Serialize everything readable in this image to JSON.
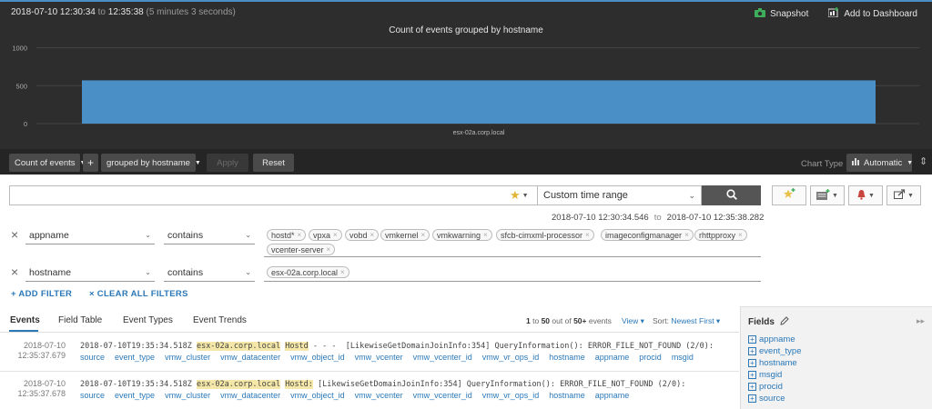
{
  "header": {
    "range_start": "2018-07-10 12:30:34",
    "range_to": "to",
    "range_end": "12:35:38",
    "range_duration": "(5 minutes 3 seconds)",
    "snapshot_label": "Snapshot",
    "add_dashboard_label": "Add to Dashboard"
  },
  "colors": {
    "accent": "#2a78b8",
    "bar": "#4a90c6",
    "dark_bg": "#2d2d2d",
    "highlight": "#f4e7a8"
  },
  "chart_data": {
    "type": "bar",
    "title": "Count of events grouped by hostname",
    "categories": [
      "esx-02a.corp.local"
    ],
    "values": [
      570
    ],
    "yticks": [
      0,
      500,
      1000
    ],
    "ylim": [
      0,
      1150
    ],
    "xlabel": "",
    "ylabel": "",
    "grid": true
  },
  "chart_toolbar": {
    "metric_label": "Count of events",
    "add_label": "+",
    "group_label": "grouped by hostname",
    "apply_label": "Apply",
    "reset_label": "Reset",
    "chart_type_label": "Chart Type",
    "chart_type_value": "Automatic",
    "collapse_label": "⇕"
  },
  "search": {
    "query_value": "",
    "time_range": "Custom time range",
    "time_start": "2018-07-10 12:30:34.546",
    "time_to": "to",
    "time_end": "2018-07-10 12:35:38.282"
  },
  "filters": [
    {
      "field": "appname",
      "operator": "contains",
      "tokens": [
        "hostd*",
        "vpxa",
        "vobd",
        "vmkernel",
        "vmkwarning",
        "sfcb-cimxml-processor",
        "imageconfigmanager",
        "rhttpproxy",
        "vcenter-server"
      ]
    },
    {
      "field": "hostname",
      "operator": "contains",
      "tokens": [
        "esx-02a.corp.local"
      ]
    }
  ],
  "filter_actions": {
    "add_label": "+ ADD FILTER",
    "clear_label": "× CLEAR ALL FILTERS"
  },
  "tabs": [
    "Events",
    "Field Table",
    "Event Types",
    "Event Trends"
  ],
  "results": {
    "range_from": "1",
    "to_word": "to",
    "range_to": "50",
    "out_of": "out of",
    "total": "50+",
    "events_word": "events",
    "view_label": "View ▾",
    "sort_label": "Sort:",
    "sort_value": "Newest First ▾"
  },
  "events": [
    {
      "date": "2018-07-10",
      "time": "12:35:37.679",
      "timestamp": "2018-07-10T19:35:34.518Z",
      "host": "esx-02a.corp.local",
      "app": "Hostd",
      "rest": " - - -  [LikewiseGetDomainJoinInfo:354] QueryInformation(): ERROR_FILE_NOT_FOUND (2/0):",
      "fields": [
        "source",
        "event_type",
        "vmw_cluster",
        "vmw_datacenter",
        "vmw_object_id",
        "vmw_vcenter",
        "vmw_vcenter_id",
        "vmw_vr_ops_id",
        "hostname",
        "appname",
        "procid",
        "msgid"
      ]
    },
    {
      "date": "2018-07-10",
      "time": "12:35:37.678",
      "timestamp": "2018-07-10T19:35:34.518Z",
      "host": "esx-02a.corp.local",
      "app": "Hostd:",
      "rest": " [LikewiseGetDomainJoinInfo:354] QueryInformation(): ERROR_FILE_NOT_FOUND (2/0):",
      "fields": [
        "source",
        "event_type",
        "vmw_cluster",
        "vmw_datacenter",
        "vmw_object_id",
        "vmw_vcenter",
        "vmw_vcenter_id",
        "vmw_vr_ops_id",
        "hostname",
        "appname"
      ]
    }
  ],
  "fields_panel": {
    "title": "Fields",
    "items": [
      "appname",
      "event_type",
      "hostname",
      "msgid",
      "procid",
      "source"
    ]
  },
  "icons": {
    "snapshot": "camera-icon",
    "dashboard": "dashboard-add-icon",
    "search": "magnifier-icon",
    "favorite": "star-icon",
    "alert": "bell-icon",
    "export": "share-icon",
    "edit": "pencil-icon"
  }
}
